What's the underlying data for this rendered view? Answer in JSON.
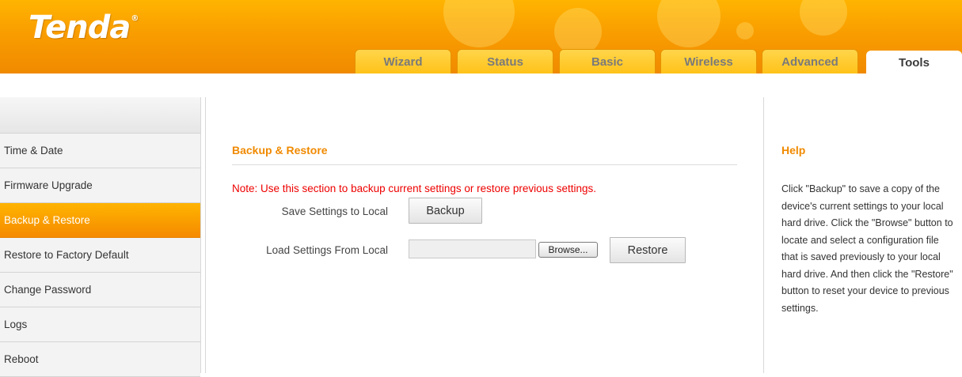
{
  "brand": {
    "logo": "Tenda",
    "registered": "®"
  },
  "tabs": [
    {
      "label": "Wizard"
    },
    {
      "label": "Status"
    },
    {
      "label": "Basic"
    },
    {
      "label": "Wireless"
    },
    {
      "label": "Advanced"
    },
    {
      "label": "Tools",
      "active": true
    }
  ],
  "sidebar": {
    "items": [
      {
        "label": "Time & Date"
      },
      {
        "label": "Firmware Upgrade"
      },
      {
        "label": "Backup & Restore",
        "active": true
      },
      {
        "label": "Restore to Factory Default"
      },
      {
        "label": "Change Password"
      },
      {
        "label": "Logs"
      },
      {
        "label": "Reboot"
      }
    ]
  },
  "main": {
    "title": "Backup & Restore",
    "note": "Note: Use this section to backup current settings or restore previous settings.",
    "save_label": "Save Settings to Local",
    "backup_button": "Backup",
    "load_label": "Load Settings From Local",
    "file_value": "",
    "browse_button": "Browse...",
    "restore_button": "Restore"
  },
  "help": {
    "title": "Help",
    "text": "Click \"Backup\" to save a copy of the device's current settings to your local hard drive. Click the \"Browse\" button to locate and select a configuration file that is saved previously to your local hard drive. And then click the \"Restore\" button to reset your device to previous settings."
  },
  "colors": {
    "accent": "#f08a00",
    "header": "#ffa800",
    "note": "#ee0000"
  }
}
